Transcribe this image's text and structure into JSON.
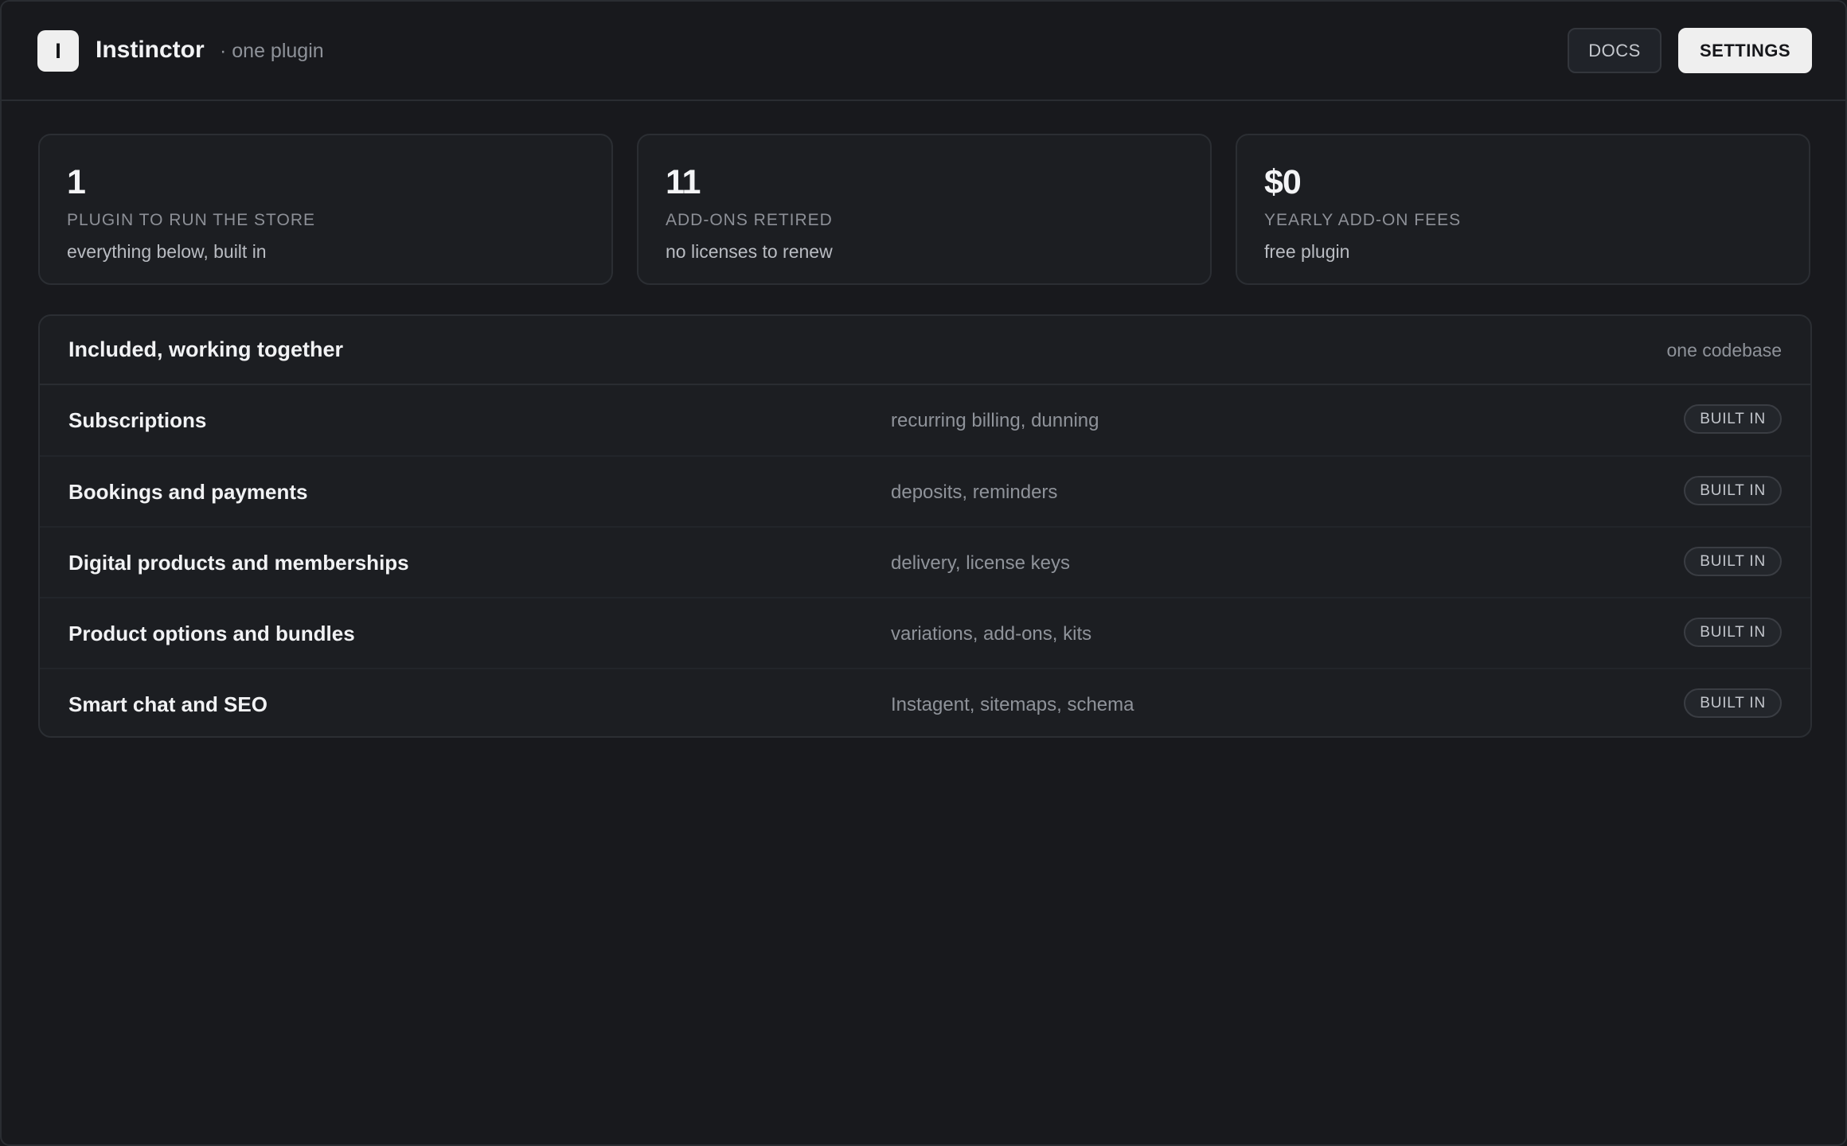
{
  "header": {
    "logo_letter": "I",
    "app_name": "Instinctor",
    "app_subtitle": "· one plugin",
    "docs_label": "DOCS",
    "settings_label": "SETTINGS"
  },
  "stats": [
    {
      "value": "1",
      "label": "PLUGIN TO RUN THE STORE",
      "note": "everything below, built in"
    },
    {
      "value": "11",
      "label": "ADD-ONS RETIRED",
      "note": "no licenses to renew"
    },
    {
      "value": "$0",
      "label": "YEARLY ADD-ON FEES",
      "note": "free plugin"
    }
  ],
  "features": {
    "title": "Included, working together",
    "meta": "one codebase",
    "rows": [
      {
        "name": "Subscriptions",
        "description": "recurring billing, dunning",
        "badge": "BUILT IN"
      },
      {
        "name": "Bookings and payments",
        "description": "deposits, reminders",
        "badge": "BUILT IN"
      },
      {
        "name": "Digital products and memberships",
        "description": "delivery, license keys",
        "badge": "BUILT IN"
      },
      {
        "name": "Product options and bundles",
        "description": "variations, add-ons, kits",
        "badge": "BUILT IN"
      },
      {
        "name": "Smart chat and SEO",
        "description": "Instagent, sitemaps, schema",
        "badge": "BUILT IN"
      }
    ]
  },
  "colors": {
    "background": "#18191d",
    "card": "#1c1e22",
    "border": "#2b2e33",
    "primary_button": "#efefef",
    "text_primary": "#f1f2f4",
    "text_muted": "#8e9299"
  }
}
